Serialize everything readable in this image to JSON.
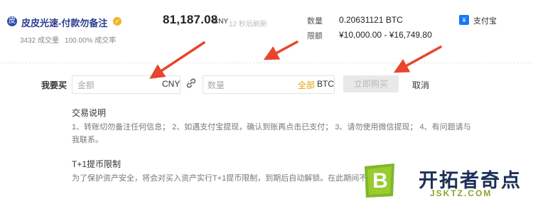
{
  "merchant": {
    "avatar_glyph": "皮",
    "name": "皮皮光速-付款勿备注",
    "verified_glyph": "✓",
    "stats": [
      "3432 成交量",
      "100.00% 成交率"
    ]
  },
  "quote": {
    "price": "81,187.08",
    "currency": "CNY",
    "refresh_note": "12 秒后刷新"
  },
  "order_info": {
    "quantity_label": "数量",
    "quantity_value": "0.20631121 BTC",
    "limit_label": "限额",
    "limit_value": "¥10,000.00 - ¥16,749.80"
  },
  "payment": {
    "icon_glyph": "¥",
    "label": "支付宝",
    "brand_color": "#1677ff"
  },
  "buy_form": {
    "label": "我要买",
    "amount_placeholder": "金额",
    "amount_unit": "CNY",
    "quantity_placeholder": "数量",
    "all_label": "全部",
    "quantity_unit": "BTC",
    "buy_button": "立即购买",
    "cancel": "取消"
  },
  "notes": {
    "trade_title": "交易说明",
    "trade_line1": "1、转账切勿备注任何信息； 2、如遇支付宝提现，确认到账再点击已支付； 3、请勿使用微信提现； 4、有问题请与",
    "trade_line2": "我联系。",
    "limit_title": "T+1提币限制",
    "limit_text": "为了保护资产安全，将会对买入资产实行T+1提币限制，到期后自动解锁。在此期间不"
  },
  "watermark": {
    "logo_letter": "B",
    "title": "开拓者奇点",
    "domain": "JSKTZ.COM"
  },
  "colors": {
    "accent_red": "#e8452c",
    "all_gold": "#e6a200",
    "merchant_blue": "#2c3e8f"
  }
}
